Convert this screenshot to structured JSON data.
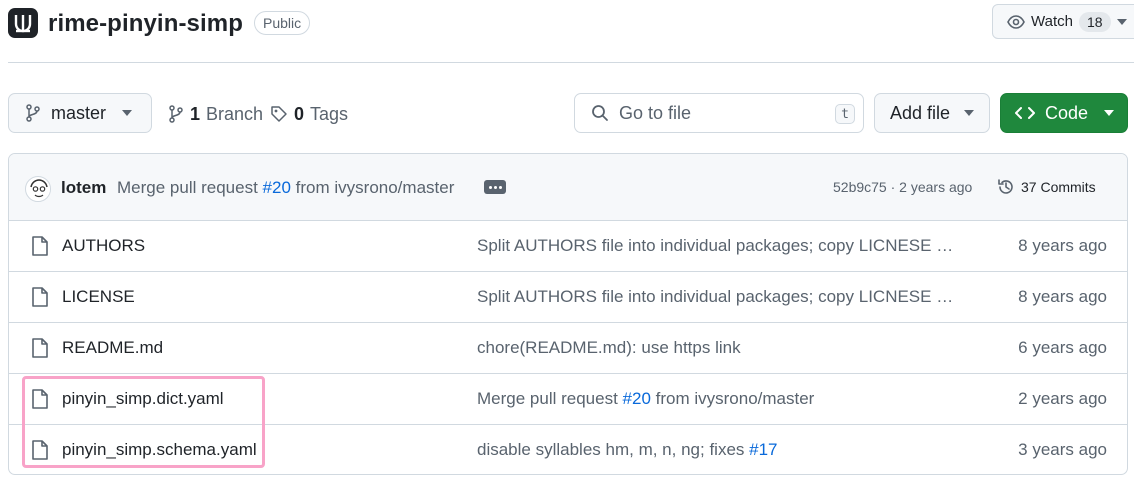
{
  "repo": {
    "name": "rime-pinyin-simp",
    "visibility": "Public"
  },
  "watch": {
    "label": "Watch",
    "count": "18"
  },
  "toolbar": {
    "branch_label": "master",
    "branch_count": "1",
    "branch_word": "Branch",
    "tags_count": "0",
    "tags_word": "Tags",
    "goto_placeholder": "Go to file",
    "goto_shortcut": "t",
    "add_file_label": "Add file",
    "code_label": "Code"
  },
  "latest_commit": {
    "author": "lotem",
    "message_prefix": "Merge pull request",
    "pr_link": "#20",
    "message_suffix": "from ivysrono/master",
    "meta": "52b9c75 · 2 years ago",
    "commits_label": "37 Commits"
  },
  "files": [
    {
      "name": "AUTHORS",
      "msg_prefix": "Split AUTHORS file into individual packages; copy LICNESE files to each package",
      "msg_link": "",
      "msg_suffix": "",
      "time": "8 years ago"
    },
    {
      "name": "LICENSE",
      "msg_prefix": "Split AUTHORS file into individual packages; copy LICNESE files to each package",
      "msg_link": "",
      "msg_suffix": "",
      "time": "8 years ago"
    },
    {
      "name": "README.md",
      "msg_prefix": "chore(README.md): use https link",
      "msg_link": "",
      "msg_suffix": "",
      "time": "6 years ago"
    },
    {
      "name": "pinyin_simp.dict.yaml",
      "msg_prefix": "Merge pull request ",
      "msg_link": "#20",
      "msg_suffix": " from ivysrono/master",
      "time": "2 years ago"
    },
    {
      "name": "pinyin_simp.schema.yaml",
      "msg_prefix": "disable syllables hm, m, n, ng; fixes ",
      "msg_link": "#17",
      "msg_suffix": "",
      "time": "3 years ago"
    }
  ],
  "colors": {
    "accent_link": "#0969da",
    "code_button": "#1f883d",
    "highlight": "#f8a3c8"
  }
}
